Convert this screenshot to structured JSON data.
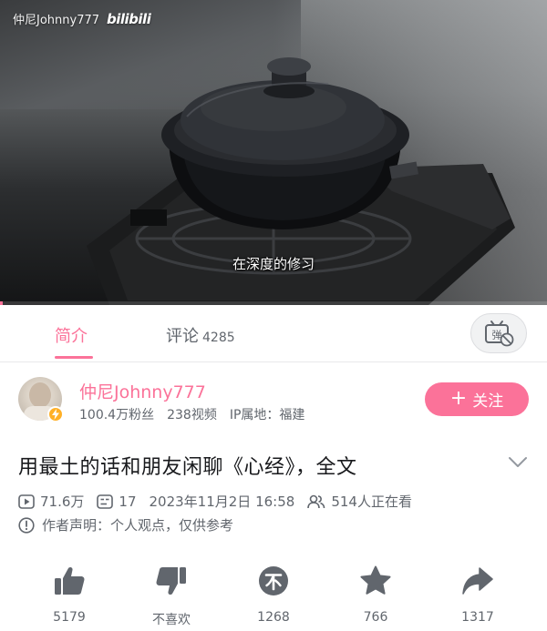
{
  "video": {
    "watermark_user": "仲尼Johnny777",
    "watermark_logo": "bilibili",
    "subtitle": "在深度的修习",
    "progress_fraction": 0.005
  },
  "tabs": {
    "intro_label": "简介",
    "comments_label": "评论",
    "comments_count": "4285",
    "danmaku_icon": "danmaku-toggle-icon"
  },
  "uploader": {
    "name": "仲尼Johnny777",
    "fans": "100.4万粉丝",
    "videos": "238视频",
    "ip": "IP属地：福建",
    "follow_label": "关注"
  },
  "video_info": {
    "title": "用最土的话和朋友闲聊《心经》，全文",
    "views": "71.6万",
    "danmaku_count": "17",
    "publish_time": "2023年11月2日 16:58",
    "watching": "514人正在看",
    "disclaimer": "作者声明：个人观点，仅供参考"
  },
  "actions": [
    {
      "icon": "thumbs-up-icon",
      "label": "5179"
    },
    {
      "icon": "thumbs-down-icon",
      "label": "不喜欢"
    },
    {
      "icon": "coin-icon",
      "label": "1268"
    },
    {
      "icon": "star-icon",
      "label": "766"
    },
    {
      "icon": "share-icon",
      "label": "1317"
    }
  ],
  "colors": {
    "accent": "#fb7299",
    "text_primary": "#18191c",
    "text_secondary": "#61666d",
    "icon_gray": "#61666d"
  }
}
